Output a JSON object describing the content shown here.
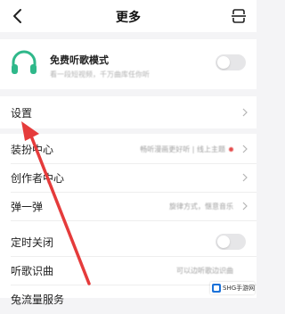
{
  "header": {
    "title": "更多"
  },
  "free_mode": {
    "title": "免费听歌模式",
    "subtitle": "看一段短视频，千万曲库任你听"
  },
  "settings": {
    "label": "设置"
  },
  "items": [
    {
      "label": "装扮中心",
      "value": "畅听漫画更好听 | 线上主题"
    },
    {
      "label": "创作者中心",
      "value": ""
    },
    {
      "label": "弹一弹",
      "value": "旋律方式，惬意音乐"
    },
    {
      "label": "定时关闭",
      "value": ""
    },
    {
      "label": "听歌识曲",
      "value": "可以边听歌边识曲"
    },
    {
      "label": "兔流量服务",
      "value": ""
    }
  ],
  "watermark": {
    "text": "SHG手游网"
  },
  "colors": {
    "accent": "#2fb88a",
    "arrow": "#e53b3b",
    "badge": "#e44a4a"
  }
}
